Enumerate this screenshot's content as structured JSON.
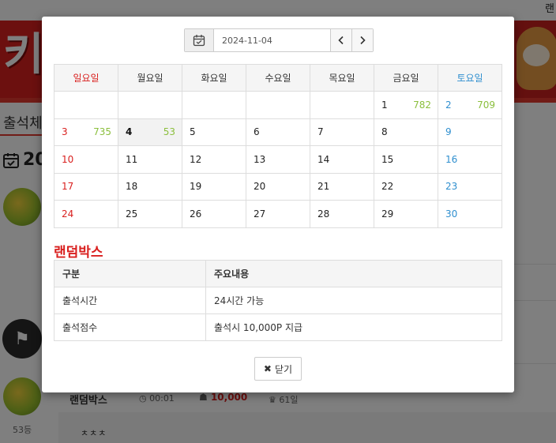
{
  "background": {
    "corner_text": "랜",
    "section_title": "출석체",
    "date_fragment": "20",
    "rank": "53등",
    "row": {
      "name": "랜덤박스",
      "time": "00:01",
      "points": "10,000",
      "days": "61일",
      "comment": "ㅊㅊㅊ"
    }
  },
  "date_picker": {
    "value": "2024-11-04",
    "icon": "calendar-icon",
    "prev_icon": "chevron-left-icon",
    "next_icon": "chevron-right-icon"
  },
  "calendar": {
    "weekdays": [
      "일요일",
      "월요일",
      "화요일",
      "수요일",
      "목요일",
      "금요일",
      "토요일"
    ],
    "today": "4",
    "weeks": [
      [
        {
          "day": ""
        },
        {
          "day": ""
        },
        {
          "day": ""
        },
        {
          "day": ""
        },
        {
          "day": ""
        },
        {
          "day": "1",
          "count": "782"
        },
        {
          "day": "2",
          "count": "709"
        }
      ],
      [
        {
          "day": "3",
          "count": "735"
        },
        {
          "day": "4",
          "count": "53"
        },
        {
          "day": "5"
        },
        {
          "day": "6"
        },
        {
          "day": "7"
        },
        {
          "day": "8"
        },
        {
          "day": "9"
        }
      ],
      [
        {
          "day": "10"
        },
        {
          "day": "11"
        },
        {
          "day": "12"
        },
        {
          "day": "13"
        },
        {
          "day": "14"
        },
        {
          "day": "15"
        },
        {
          "day": "16"
        }
      ],
      [
        {
          "day": "17"
        },
        {
          "day": "18"
        },
        {
          "day": "19"
        },
        {
          "day": "20"
        },
        {
          "day": "21"
        },
        {
          "day": "22"
        },
        {
          "day": "23"
        }
      ],
      [
        {
          "day": "24"
        },
        {
          "day": "25"
        },
        {
          "day": "26"
        },
        {
          "day": "27"
        },
        {
          "day": "28"
        },
        {
          "day": "29"
        },
        {
          "day": "30"
        }
      ]
    ]
  },
  "random_box": {
    "title": "랜덤박스",
    "headers": [
      "구분",
      "주요내용"
    ],
    "rows": [
      [
        "출석시간",
        "24시간 가능"
      ],
      [
        "출석점수",
        "출석시 10,000P 지급"
      ]
    ]
  },
  "close_button": {
    "label": "닫기",
    "icon": "close-icon"
  },
  "colors": {
    "sunday": "#d9201f",
    "saturday": "#2f8fcf",
    "count": "#8bbf3d",
    "accent": "#d9201f"
  }
}
